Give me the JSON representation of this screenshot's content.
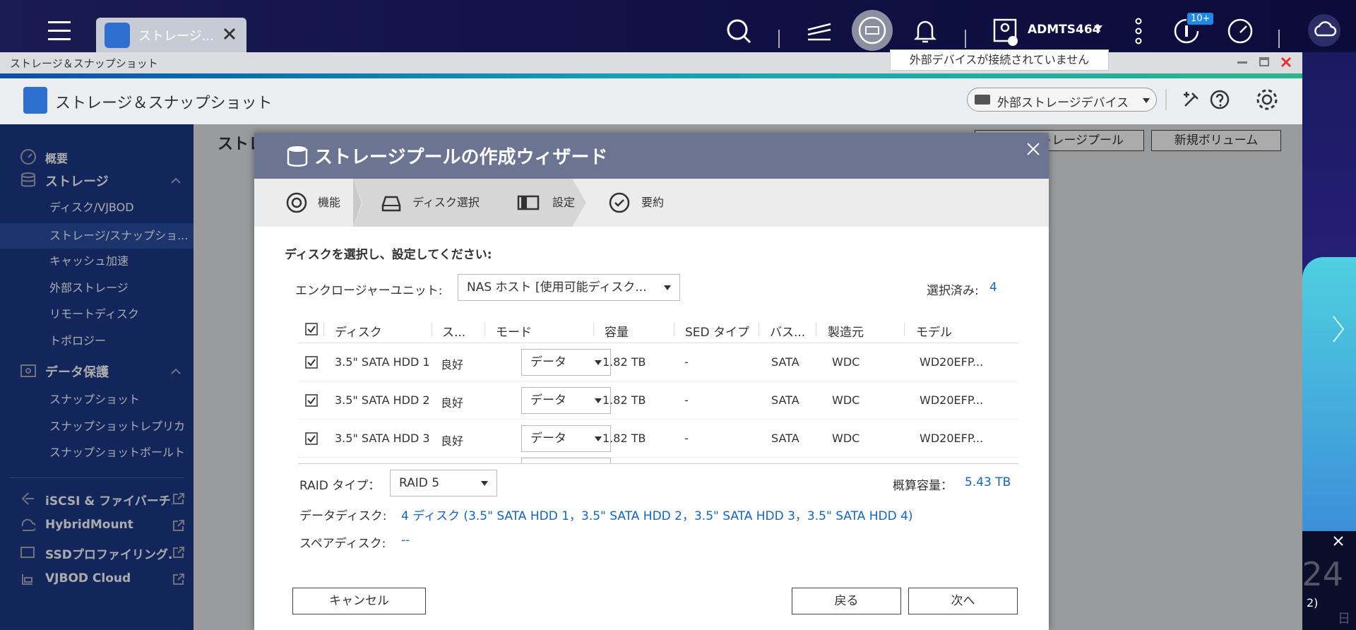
{
  "topbar": {
    "app_tab_label": "ストレージ...",
    "user_name": "ADMTS464",
    "notification_badge": "10+",
    "tooltip": "外部デバイスが接続されていません"
  },
  "window": {
    "title": "ストレージ＆スナップショット",
    "app_title": "ストレージ＆スナップショット",
    "external_device_button": "外部ストレージデバイス",
    "content_title": "ストレ",
    "new_pool_button": "トレージプール",
    "new_volume_button": "新規ボリューム"
  },
  "sidebar": {
    "overview": "概要",
    "storage": "ストレージ",
    "storage_items": [
      "ディスク/VJBOD",
      "ストレージ/スナップショ...",
      "キャッシュ加速",
      "外部ストレージ",
      "リモートディスク",
      "トポロジー"
    ],
    "data_protection": "データ保護",
    "protection_items": [
      "スナップショット",
      "スナップショットレプリカ",
      "スナップショットボールト"
    ],
    "links": [
      "iSCSI & ファイバーチ...",
      "HybridMount",
      "SSDプロファイリング...",
      "VJBOD Cloud"
    ]
  },
  "dialog": {
    "title": "ストレージプールの作成ウィザード",
    "steps": [
      "機能",
      "ディスク選択",
      "設定",
      "要約"
    ],
    "instruction": "ディスクを選択し、設定してください:",
    "enclosure_label": "エンクロージャーユニット:",
    "enclosure_value": "NAS ホスト [使用可能ディスク...",
    "selected_label": "選択済み:",
    "selected_count": "4",
    "columns": [
      "ディスク",
      "ス...",
      "モード",
      "容量",
      "SED タイプ",
      "バス...",
      "製造元",
      "モデル"
    ],
    "rows": [
      {
        "disk": "3.5\" SATA HDD 1",
        "status": "良好",
        "mode": "データ",
        "capacity": "1.82 TB",
        "sed": "-",
        "bus": "SATA",
        "vendor": "WDC",
        "model": "WD20EFP..."
      },
      {
        "disk": "3.5\" SATA HDD 2",
        "status": "良好",
        "mode": "データ",
        "capacity": "1.82 TB",
        "sed": "-",
        "bus": "SATA",
        "vendor": "WDC",
        "model": "WD20EFP..."
      },
      {
        "disk": "3.5\" SATA HDD 3",
        "status": "良好",
        "mode": "データ",
        "capacity": "1.82 TB",
        "sed": "-",
        "bus": "SATA",
        "vendor": "WDC",
        "model": "WD20EFP..."
      }
    ],
    "raid_label": "RAID タイプ：",
    "raid_value": "RAID 5",
    "capacity_label": "概算容量：",
    "capacity_value": "5.43 TB",
    "data_disk_label": "データディスク:",
    "data_disk_value": "4 ディスク (3.5\" SATA HDD 1，3.5\" SATA HDD 2，3.5\" SATA HDD 3，3.5\" SATA HDD 4)",
    "spare_disk_label": "スペアディスク:",
    "spare_disk_value": "--",
    "cancel_button": "キャンセル",
    "back_button": "戻る",
    "next_button": "次へ"
  },
  "right_panel": {
    "partial_number": "24",
    "partial_text": "2)",
    "partial_char": "日"
  }
}
